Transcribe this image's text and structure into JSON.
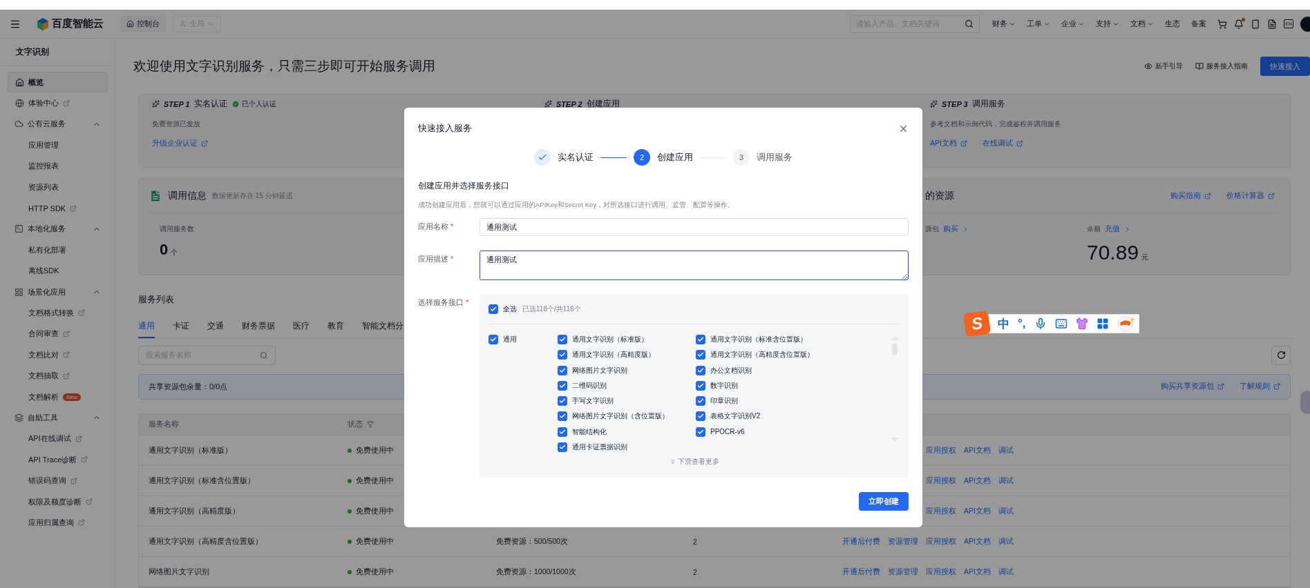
{
  "topbar": {
    "logo": "百度智能云",
    "console": "控制台",
    "region": {
      "label": "全局",
      "disabled": true
    },
    "search": {
      "placeholder": "请输入产品、文档关键词"
    },
    "menu": [
      {
        "label": "财务",
        "dropdown": true
      },
      {
        "label": "工单",
        "dropdown": true
      },
      {
        "label": "企业",
        "dropdown": true
      },
      {
        "label": "支持",
        "dropdown": true
      },
      {
        "label": "文档",
        "dropdown": true
      },
      {
        "label": "生态",
        "dropdown": false
      },
      {
        "label": "备案",
        "dropdown": false
      }
    ],
    "unread": true,
    "language": "EN"
  },
  "sidebar": {
    "title": "文字识别",
    "items": [
      {
        "kind": "link",
        "label": "概览",
        "selected": true
      },
      {
        "kind": "link",
        "label": "体验中心",
        "selected": false,
        "external": true
      },
      {
        "kind": "group",
        "label": "公有云服务",
        "expanded": true,
        "children": [
          {
            "label": "应用管理",
            "selected": false
          },
          {
            "label": "监控报表",
            "selected": false
          },
          {
            "label": "资源列表",
            "selected": false
          },
          {
            "label": "HTTP SDK",
            "selected": false,
            "external": true
          }
        ]
      },
      {
        "kind": "group",
        "label": "本地化服务",
        "expanded": true,
        "children": [
          {
            "label": "私有化部署",
            "selected": false
          },
          {
            "label": "离线SDK",
            "selected": false
          }
        ]
      },
      {
        "kind": "group",
        "label": "场景化应用",
        "expanded": true,
        "children": [
          {
            "label": "文档格式转换",
            "selected": false,
            "external": true
          },
          {
            "label": "合同审查",
            "selected": false,
            "external": true
          },
          {
            "label": "文档比对",
            "selected": false,
            "external": true
          },
          {
            "label": "文档抽取",
            "selected": false,
            "external": true
          },
          {
            "label": "文档解析",
            "selected": false,
            "badge": "New"
          }
        ]
      },
      {
        "kind": "group",
        "label": "自助工具",
        "expanded": true,
        "children": [
          {
            "label": "API在线调试",
            "selected": false,
            "external": true
          },
          {
            "label": "API Trace诊断",
            "selected": false,
            "external": true
          },
          {
            "label": "错误码查询",
            "selected": false,
            "external": true
          },
          {
            "label": "权限及额度诊断",
            "selected": false,
            "external": true
          },
          {
            "label": "应用归属查询",
            "selected": false,
            "external": true
          }
        ]
      }
    ]
  },
  "header": {
    "title": "欢迎使用文字识别服务，只需三步即可开始服务调用",
    "links": [
      "新手引导",
      "服务接入指南"
    ],
    "primary_button": "快速接入"
  },
  "steps": [
    {
      "step": "STEP 1",
      "title": "实名认证",
      "badge": "已个人认证",
      "description": "免费资源已发放",
      "links": [
        "升级企业认证"
      ]
    },
    {
      "step": "STEP 2",
      "title": "创建应用"
    },
    {
      "step": "STEP 3",
      "title": "调用服务",
      "description": "参考文档和示例代码，完成鉴权并调用服务",
      "links": [
        "API文档",
        "在线调试"
      ]
    }
  ],
  "usage": {
    "title": "调用信息",
    "note": "数据更新存在 15 分钟延迟",
    "stats": [
      {
        "label": "调用服务数",
        "value": "0",
        "unit": "个"
      }
    ]
  },
  "resources": {
    "title": "的资源",
    "links": [
      "购买指南",
      "价格计算器"
    ],
    "stats": [
      {
        "label": "源包",
        "action": "购买"
      },
      {
        "label": "余额",
        "action": "充值",
        "value": "70.89",
        "unit": "元"
      }
    ]
  },
  "service_list": {
    "title": "服务列表",
    "tabs": [
      {
        "label": "通用",
        "selected": true
      },
      {
        "label": "卡证",
        "selected": false
      },
      {
        "label": "交通",
        "selected": false
      },
      {
        "label": "财务票据",
        "selected": false
      },
      {
        "label": "医疗",
        "selected": false
      },
      {
        "label": "教育",
        "selected": false
      },
      {
        "label": "智能文档分",
        "selected": false
      }
    ],
    "search": {
      "placeholder": "搜索服务名称"
    },
    "shared": {
      "text": "共享资源包余量：0/0点",
      "links": [
        "购买共享资源包",
        "了解规则"
      ]
    },
    "columns": [
      "服务名称",
      "状态"
    ],
    "rows": [
      {
        "name": "通用文字识别（标准版）",
        "status": "免费使用中",
        "actions": [
          "应用授权",
          "API文档",
          "调试"
        ]
      },
      {
        "name": "通用文字识别（标准含位置版）",
        "status": "免费使用中",
        "actions": [
          "应用授权",
          "API文档",
          "调试"
        ]
      },
      {
        "name": "通用文字识别（高精度版）",
        "status": "免费使用中",
        "actions": [
          "应用授权",
          "API文档",
          "调试"
        ]
      },
      {
        "name": "通用文字识别（高精度含位置版）",
        "status": "免费使用中",
        "column_3": "免费资源：500/500次",
        "column_4": "2",
        "actions": [
          "开通后付费",
          "资源管理",
          "应用授权",
          "API文档",
          "调试"
        ]
      },
      {
        "name": "网络图片文字识别",
        "status": "免费使用中",
        "column_3": "免费资源：1000/1000次",
        "column_4": "2",
        "actions": [
          "开通后付费",
          "资源管理",
          "应用授权",
          "API文档",
          "调试"
        ]
      }
    ]
  },
  "modal": {
    "title": "快速接入服务",
    "steps": [
      {
        "label": "实名认证",
        "done": true,
        "active": false
      },
      {
        "number": "2",
        "label": "创建应用",
        "done": false,
        "active": true
      },
      {
        "number": "3",
        "label": "调用服务",
        "done": false,
        "active": false
      }
    ],
    "section_title": "创建应用并选择服务接口",
    "section_note": "成功创建应用后，您就可以通过应用的APIKey和Secret Key，对所选接口进行调用、监管、配置等操作。",
    "fields": [
      {
        "kind": "input",
        "label": "应用名称",
        "required_mark": "*",
        "value": "通用测试",
        "focused": false
      },
      {
        "kind": "textarea",
        "label": "应用描述",
        "required_mark": "*",
        "value": "通用测试",
        "focused": true
      }
    ],
    "services": {
      "label": "选择服务接口",
      "required_mark": "*",
      "select_all": {
        "label": "全选",
        "checked": true
      },
      "count": "已选118个/共118个",
      "categories": [
        {
          "label": "通用",
          "checked": true,
          "items": [
            {
              "label": "通用文字识别（标准版）",
              "checked": true
            },
            {
              "label": "通用文字识别（标准含位置版）",
              "checked": true
            },
            {
              "label": "通用文字识别（高精度版）",
              "checked": true
            },
            {
              "label": "通用文字识别（高精度含位置版）",
              "checked": true
            },
            {
              "label": "网络图片文字识别",
              "checked": true
            },
            {
              "label": "办公文档识别",
              "checked": true
            },
            {
              "label": "二维码识别",
              "checked": true
            },
            {
              "label": "数字识别",
              "checked": true
            },
            {
              "label": "手写文字识别",
              "checked": true
            },
            {
              "label": "印章识别",
              "checked": true
            },
            {
              "label": "网络图片文字识别（含位置版）",
              "checked": true
            },
            {
              "label": "表格文字识别V2",
              "checked": true
            },
            {
              "label": "智能结构化",
              "checked": true
            },
            {
              "label": "PPOCR-v6",
              "checked": true
            },
            {
              "label": "通用卡证票据识别",
              "checked": true
            }
          ]
        }
      ],
      "more": "下滑查看更多"
    },
    "submit": "立即创建"
  },
  "ime_toolbar": {
    "logo": "S",
    "mode": "中",
    "punctuation": "°,"
  }
}
